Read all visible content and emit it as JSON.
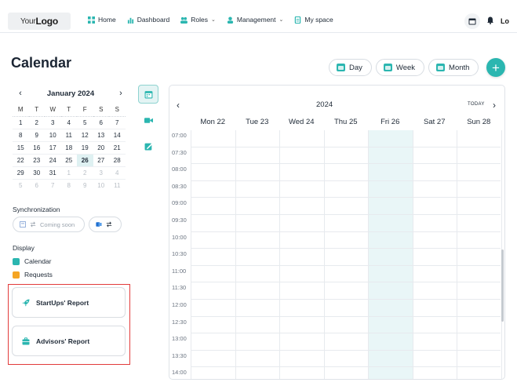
{
  "header": {
    "logo_prefix": "Your",
    "logo_main": "Logo",
    "nav": [
      {
        "label": "Home",
        "icon": "grid-icon",
        "dropdown": false
      },
      {
        "label": "Dashboard",
        "icon": "chart-icon",
        "dropdown": false
      },
      {
        "label": "Roles",
        "icon": "users-icon",
        "dropdown": true
      },
      {
        "label": "Management",
        "icon": "user-icon",
        "dropdown": true
      },
      {
        "label": "My space",
        "icon": "document-icon",
        "dropdown": false
      }
    ],
    "right_logo": "Lo"
  },
  "page": {
    "title": "Calendar"
  },
  "views": {
    "day": "Day",
    "week": "Week",
    "month": "Month",
    "add": "+"
  },
  "mini_calendar": {
    "title": "January 2024",
    "prev": "‹",
    "next": "›",
    "weekdays": [
      "M",
      "T",
      "W",
      "T",
      "F",
      "S",
      "S"
    ],
    "weeks": [
      [
        "1",
        "2",
        "3",
        "4",
        "5",
        "6",
        "7"
      ],
      [
        "8",
        "9",
        "10",
        "11",
        "12",
        "13",
        "14"
      ],
      [
        "15",
        "16",
        "17",
        "18",
        "19",
        "20",
        "21"
      ],
      [
        "22",
        "23",
        "24",
        "25",
        "26",
        "27",
        "28"
      ],
      [
        "29",
        "30",
        "31",
        "1",
        "2",
        "3",
        "4"
      ],
      [
        "5",
        "6",
        "7",
        "8",
        "9",
        "10",
        "11"
      ]
    ],
    "selected": "26"
  },
  "sync": {
    "label": "Synchronization",
    "coming_soon": "Coming soon"
  },
  "display": {
    "label": "Display",
    "items": [
      {
        "label": "Calendar",
        "color": "#2bb6b0"
      },
      {
        "label": "Requests",
        "color": "#f5a524"
      }
    ]
  },
  "reports": [
    {
      "label": "StartUps' Report",
      "icon": "rocket-icon"
    },
    {
      "label": "Advisors' Report",
      "icon": "briefcase-icon"
    }
  ],
  "week_view": {
    "year": "2024",
    "today_label": "TODAY",
    "prev": "‹",
    "next": "›",
    "days": [
      "Mon 22",
      "Tue 23",
      "Wed 24",
      "Thu 25",
      "Fri 26",
      "Sat 27",
      "Sun 28"
    ],
    "today_index": 4,
    "times": [
      "07:00",
      "07:30",
      "08:00",
      "08:30",
      "09:00",
      "09:30",
      "10:00",
      "10:30",
      "11:00",
      "11:30",
      "12:00",
      "12:30",
      "13:00",
      "13:30",
      "14:00"
    ]
  },
  "colors": {
    "accent": "#2bb6b0",
    "highlight_border": "#e23b3b"
  }
}
